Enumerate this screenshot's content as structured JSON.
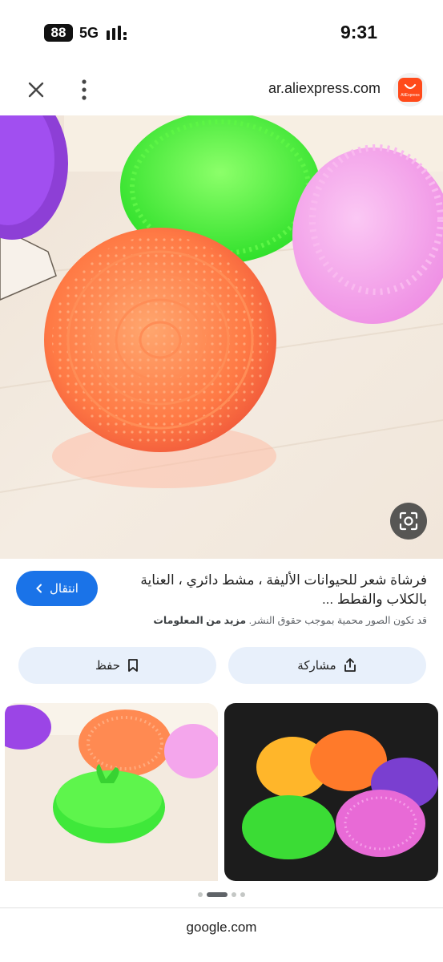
{
  "status_bar": {
    "battery": "88",
    "network": "5G",
    "time": "9:31"
  },
  "browser": {
    "domain": "ar.aliexpress.com",
    "site_logo_text": "AliExpress",
    "close_icon": "close-icon",
    "menu_icon": "more-vert-icon"
  },
  "result": {
    "title": "فرشاة شعر للحيوانات الأليفة ، مشط دائري ، العناية بالكلاب والقطط ...",
    "copyright_text": "قد تكون الصور محمية بموجب حقوق النشر.",
    "more_info": "مزيد من المعلومات",
    "visit_label": "انتقال"
  },
  "actions": {
    "share_label": "مشاركة",
    "save_label": "حفظ"
  },
  "footer": {
    "domain": "google.com"
  },
  "colors": {
    "accent": "#1a73e8",
    "action_bg": "#e8f0fb",
    "brand_aliexpress": "#ff4a1a"
  }
}
